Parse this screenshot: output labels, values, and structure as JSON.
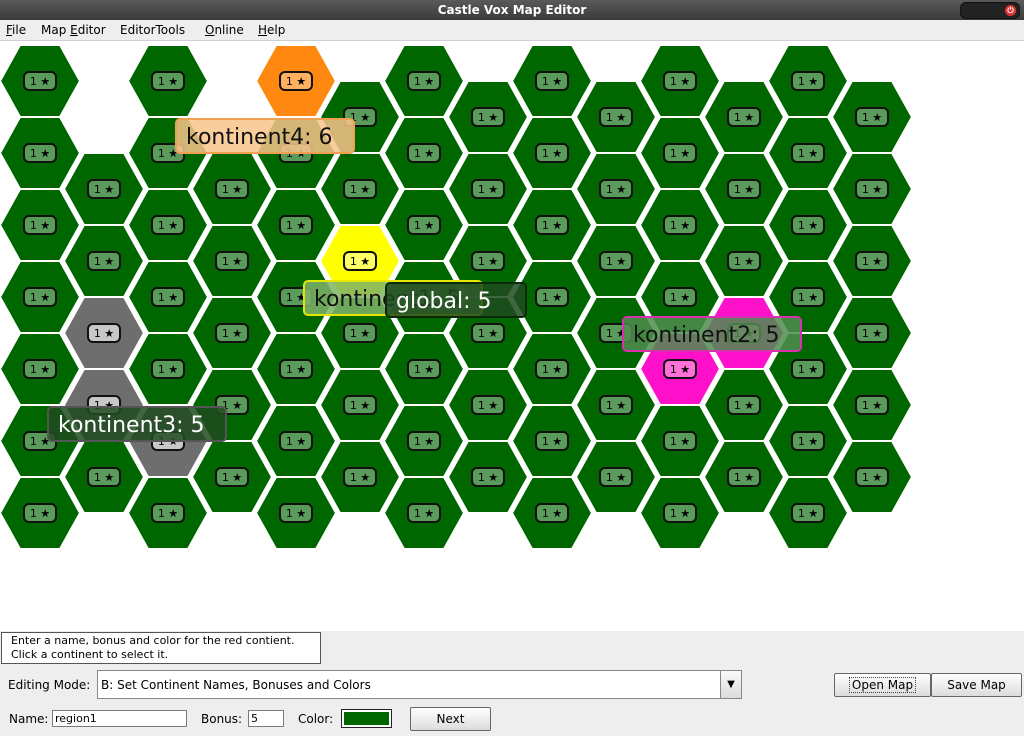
{
  "window": {
    "title": "Castle Vox Map Editor"
  },
  "menu": [
    {
      "mnemonic": "F",
      "rest": "ile"
    },
    {
      "mnemonic": "",
      "pre": "Map ",
      "mn2": "E",
      "rest": "ditor"
    },
    {
      "mnemonic": "",
      "pre": "EditorTools",
      "rest": ""
    },
    {
      "mnemonic": "O",
      "rest": "nline"
    },
    {
      "mnemonic": "H",
      "rest": "elp"
    }
  ],
  "map": {
    "region_badge": "1 ★",
    "colors": {
      "default": "#006600",
      "kontinent4": "#ff8811",
      "kontinent1": "#ffff00",
      "kontinent2": "#ff11cc",
      "kontinent3": "#6e6e6e",
      "border": "#ffffff"
    },
    "continent_labels": [
      {
        "text": "kontinent4: 6",
        "fill": "#f9c48c",
        "stroke": "#f0a050"
      },
      {
        "text": "kontinent1: 5",
        "fill": "#7fb36a",
        "stroke": "#e6e600"
      },
      {
        "text": "global: 5",
        "fill": "#1f4a1f",
        "stroke": "#0a2a0a"
      },
      {
        "text": "kontinent2: 5",
        "fill": "#4f8d4f",
        "stroke": "#d930b0"
      },
      {
        "text": "kontinent3: 5",
        "fill": "#1f4a1f",
        "stroke": "#555555"
      }
    ]
  },
  "hint": {
    "line1": "Enter a name, bonus and color for the red contient.",
    "line2": "Click a continent to select it."
  },
  "controls": {
    "editing_mode_label": "Editing Mode:",
    "editing_mode_value": "B: Set Continent Names, Bonuses and Colors",
    "open_map": "Open Map",
    "save_map": "Save Map",
    "name_label": "Name:",
    "name_value": "region1",
    "bonus_label": "Bonus:",
    "bonus_value": "5",
    "color_label": "Color:",
    "color_value": "#006600",
    "next": "Next"
  }
}
